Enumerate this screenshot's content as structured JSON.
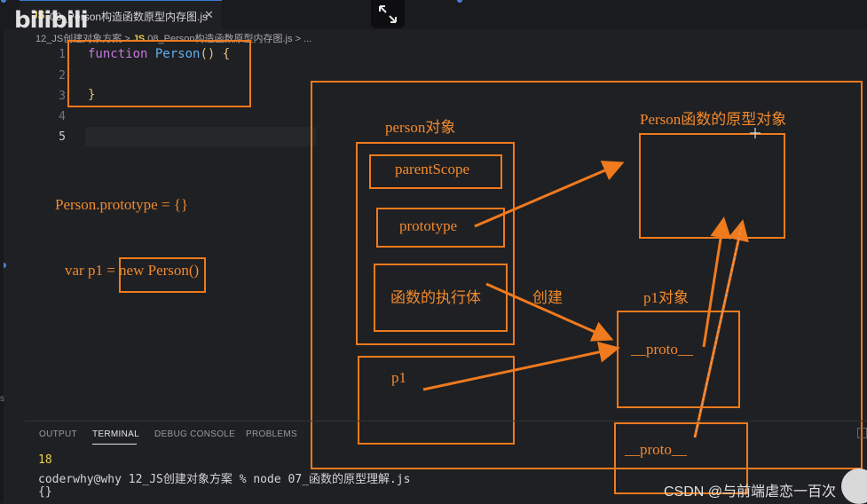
{
  "tab": {
    "file_badge": "JS",
    "title": "08_Person构造函数原型内存图.js",
    "close": "✕"
  },
  "logo": {
    "text": "bilibili"
  },
  "breadcrumb": {
    "folder": "12_JS创建对象方案",
    "sep": ">",
    "file_badge": "JS",
    "file": "08_Person构造函数原型内存图.js",
    "more": "..."
  },
  "editor": {
    "line_numbers": [
      "1",
      "2",
      "3",
      "4",
      "5"
    ],
    "active_line": 5,
    "code": {
      "kw": "function",
      "name": "Person",
      "parens": "() {",
      "close": "}"
    }
  },
  "diagram": {
    "left_note_1": "Person.prototype = {}",
    "left_note_2_prefix": "var p1 = ",
    "left_note_2_boxed": "new Person()",
    "person_obj_label": "person对象",
    "parent_scope": "parentScope",
    "prototype": "prototype",
    "func_body": "函数的执行体",
    "create_label": "创建",
    "p1_var": "p1",
    "proto_obj_label": "Person函数的原型对象",
    "p1_obj_label": "p1对象",
    "proto_1": "__proto__",
    "proto_2": "__proto__",
    "arrow_color": "#f07a1e"
  },
  "panel": {
    "tabs": [
      "OUTPUT",
      "TERMINAL",
      "DEBUG CONSOLE",
      "PROBLEMS"
    ],
    "active_tab": "TERMINAL"
  },
  "terminal": {
    "line1": "18",
    "line2": "coderwhy@why 12_JS创建对象方案 % node 07_函数的原型理解.js",
    "line3": "{}"
  },
  "watermark": "CSDN @与前端虐恋一百次",
  "edge_char": "s"
}
